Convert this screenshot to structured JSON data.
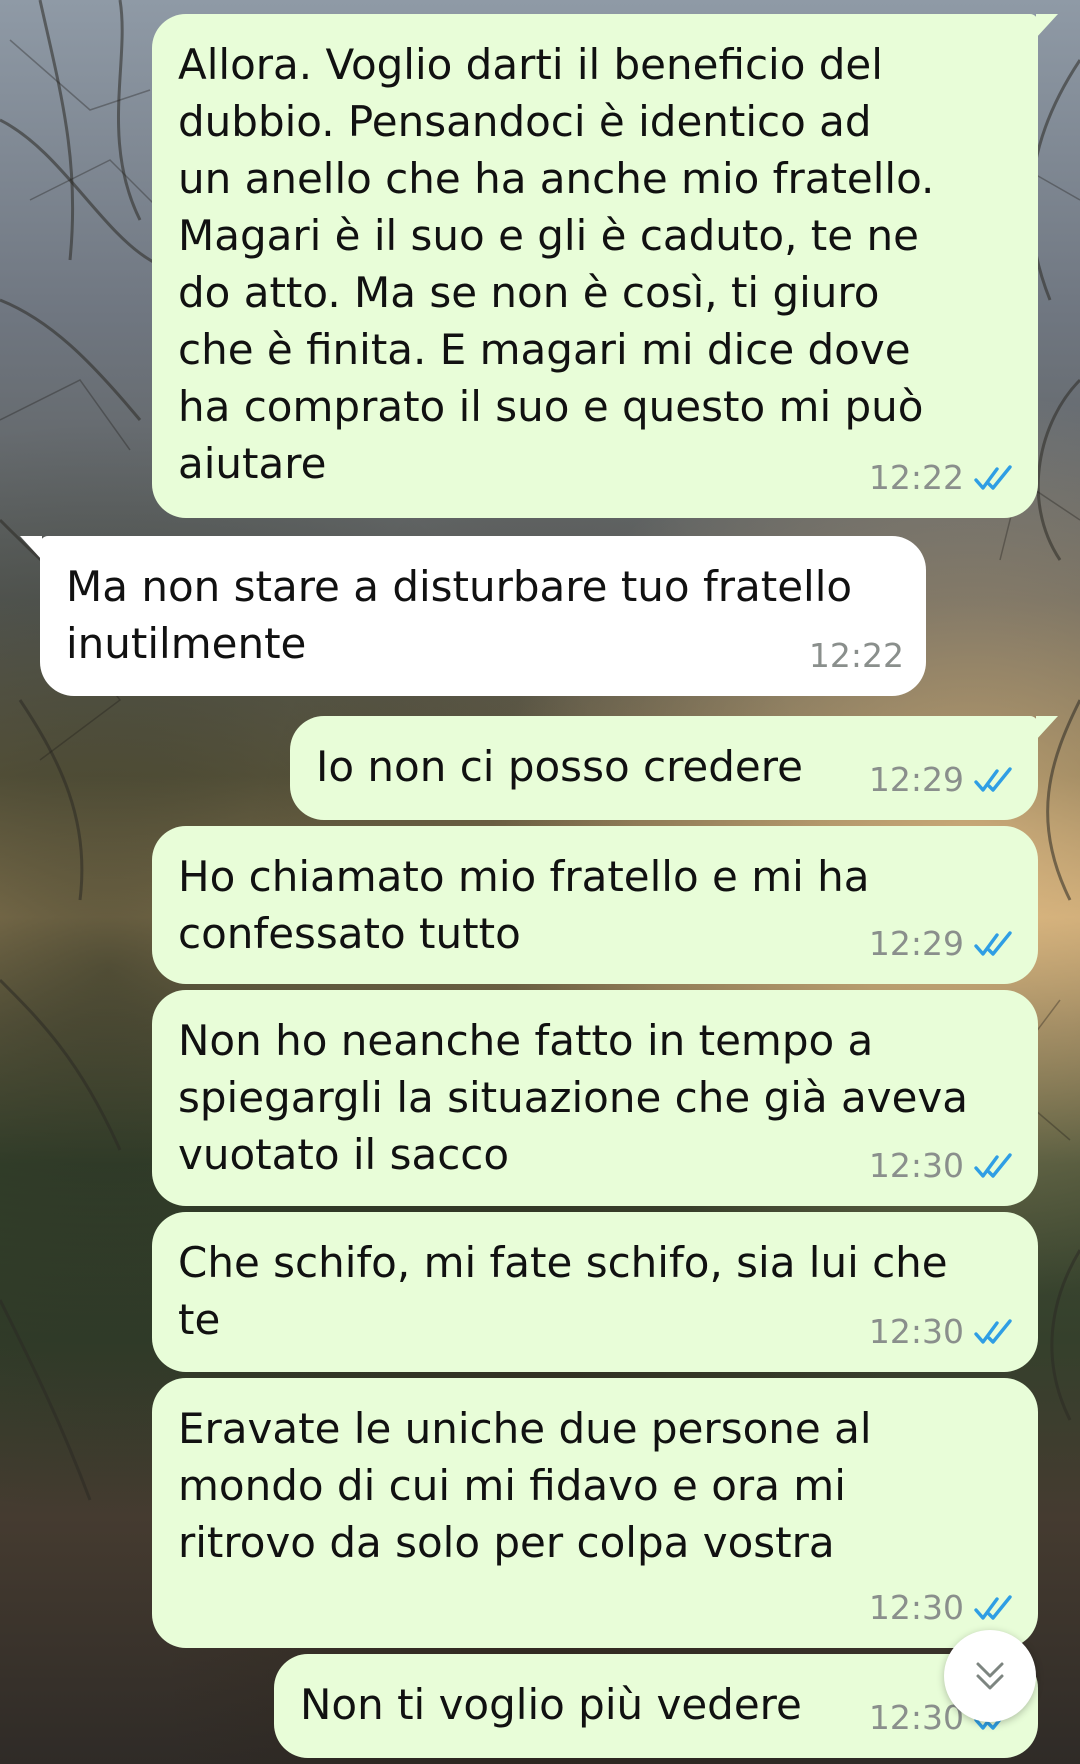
{
  "theme": {
    "outgoing_bubble": "#e8fdd8",
    "incoming_bubble": "#ffffff",
    "read_check": "#2f9ee4",
    "timestamp": "#8a8f8c"
  },
  "messages": [
    {
      "direction": "outgoing",
      "text": "Allora. Voglio darti il beneficio del\ndubbio. Pensandoci è identico ad\nun anello che ha anche mio fratello.\nMagari è il suo e gli è caduto, te ne\ndo atto. Ma se non è così, ti giuro\nche è finita. E magari mi dice dove\nha comprato il suo e questo mi può\naiutare",
      "time": "12:22",
      "status": "read"
    },
    {
      "direction": "incoming",
      "text": "Ma non stare a disturbare tuo fratello\ninutilmente",
      "time": "12:22"
    },
    {
      "direction": "outgoing",
      "text": "Io non ci posso credere",
      "time": "12:29",
      "status": "read"
    },
    {
      "direction": "outgoing",
      "text": "Ho chiamato mio fratello e mi ha\nconfessato tutto",
      "time": "12:29",
      "status": "read"
    },
    {
      "direction": "outgoing",
      "text": "Non ho neanche fatto in tempo a\nspiegargli la situazione che già aveva\nvuotato il sacco",
      "time": "12:30",
      "status": "read"
    },
    {
      "direction": "outgoing",
      "text": "Che schifo, mi fate schifo, sia lui che\nte",
      "time": "12:30",
      "status": "read"
    },
    {
      "direction": "outgoing",
      "text": "Eravate le uniche due persone al\nmondo di cui mi fidavo e ora mi\nritrovo da solo per colpa vostra",
      "time": "12:30",
      "status": "read"
    },
    {
      "direction": "outgoing",
      "text": "Non ti voglio più vedere",
      "time": "12:30",
      "status": "read"
    }
  ],
  "scroll_button": {
    "icon": "double-chevron-down-icon"
  }
}
